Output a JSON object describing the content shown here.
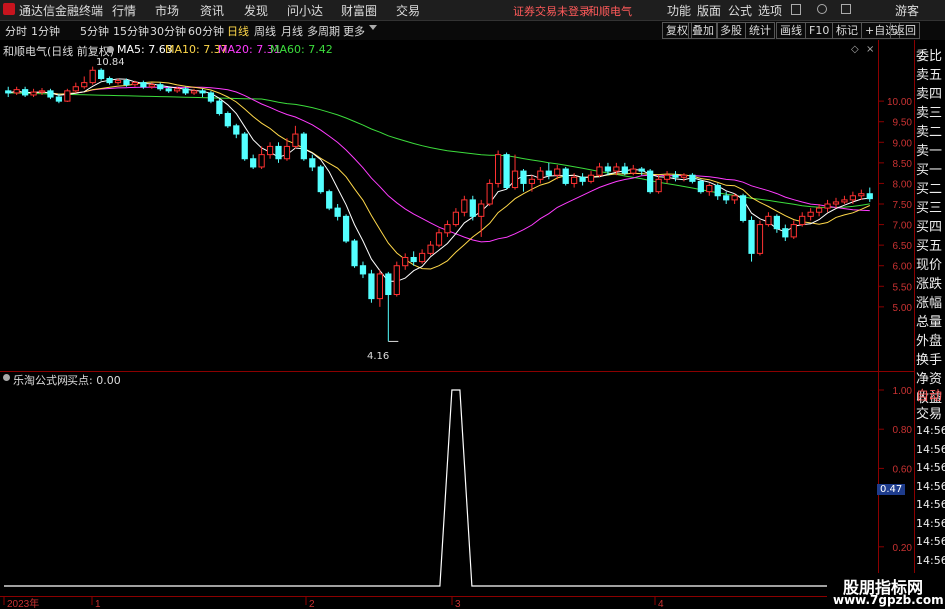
{
  "menubar": {
    "app_title": "通达信金融终端",
    "items": [
      "行情",
      "市场",
      "资讯",
      "发现",
      "问小达",
      "财富圈",
      "交易"
    ],
    "warning": "证券交易未登录",
    "stock_name": "和顺电气",
    "right_items": [
      "功能",
      "版面",
      "公式",
      "选项"
    ],
    "guest": "游客"
  },
  "toolbar": {
    "periods": [
      "分时",
      "1分钟",
      "5分钟",
      "15分钟",
      "30分钟",
      "60分钟",
      "日线",
      "周线",
      "月线",
      "多周期",
      "更多"
    ],
    "active_period": "日线",
    "right_buttons": [
      "复权",
      "叠加",
      "多股",
      "统计",
      "画线",
      "F10",
      "标记",
      "+自选",
      "返回"
    ]
  },
  "main_chart": {
    "title": "和顺电气(日线 前复权)",
    "ma_labels": [
      {
        "name": "MA5: 7.63",
        "color": "#ffffff"
      },
      {
        "name": "MA10: 7.37",
        "color": "#ffd84a"
      },
      {
        "name": "MA20: 7.31",
        "color": "#ff3cff"
      },
      {
        "name": "MA60: 7.42",
        "color": "#3cdc3c"
      }
    ],
    "high_label": "10.84",
    "low_label": "4.16",
    "y_ticks": [
      "10.00",
      "9.50",
      "9.00",
      "8.50",
      "8.00",
      "7.50",
      "7.00",
      "6.50",
      "6.00",
      "5.50",
      "5.00"
    ]
  },
  "indicator": {
    "title": "乐淘公式网",
    "value_label": "买点: 0.00",
    "y_ticks": [
      "1.00",
      "0.80",
      "0.60",
      "0.20"
    ],
    "cursor_value": "0.47"
  },
  "x_axis": {
    "labels": [
      "2023年",
      "1",
      "2",
      "3",
      "4"
    ]
  },
  "right_panel": {
    "items": [
      "委比",
      "卖五",
      "卖四",
      "卖三",
      "卖二",
      "卖一",
      "买一",
      "买二",
      "买三",
      "买四",
      "买五",
      "现价",
      "涨跌",
      "涨幅",
      "总量",
      "外盘",
      "换手",
      "净资",
      "收益"
    ],
    "tabs": [
      "自动",
      "交易"
    ],
    "times": [
      "14:56",
      "14:56",
      "14:56",
      "14:56",
      "14:56",
      "14:56",
      "14:56",
      "14:56",
      "14:56",
      "14:56"
    ]
  },
  "watermark": {
    "line1": "股朋指标网",
    "line2": "www.7gpzb.com"
  },
  "chart_data": {
    "type": "candlestick",
    "ylim": [
      4.0,
      11.0
    ],
    "candles": [
      [
        10.25,
        10.2,
        10.35,
        10.1
      ],
      [
        10.2,
        10.28,
        10.35,
        10.15
      ],
      [
        10.28,
        10.15,
        10.35,
        10.1
      ],
      [
        10.15,
        10.22,
        10.3,
        10.1
      ],
      [
        10.22,
        10.25,
        10.32,
        10.15
      ],
      [
        10.25,
        10.1,
        10.3,
        10.05
      ],
      [
        10.1,
        10.0,
        10.18,
        9.95
      ],
      [
        10.0,
        10.25,
        10.3,
        9.98
      ],
      [
        10.25,
        10.35,
        10.45,
        10.2
      ],
      [
        10.35,
        10.45,
        10.6,
        10.3
      ],
      [
        10.45,
        10.75,
        10.84,
        10.4
      ],
      [
        10.75,
        10.55,
        10.8,
        10.5
      ],
      [
        10.55,
        10.45,
        10.6,
        10.4
      ],
      [
        10.45,
        10.5,
        10.55,
        10.4
      ],
      [
        10.5,
        10.4,
        10.55,
        10.35
      ],
      [
        10.4,
        10.45,
        10.5,
        10.35
      ],
      [
        10.45,
        10.35,
        10.5,
        10.3
      ],
      [
        10.35,
        10.4,
        10.45,
        10.3
      ],
      [
        10.4,
        10.3,
        10.45,
        10.25
      ],
      [
        10.3,
        10.25,
        10.35,
        10.2
      ],
      [
        10.25,
        10.3,
        10.35,
        10.2
      ],
      [
        10.3,
        10.2,
        10.35,
        10.15
      ],
      [
        10.2,
        10.25,
        10.3,
        10.15
      ],
      [
        10.25,
        10.2,
        10.3,
        10.1
      ],
      [
        10.2,
        10.0,
        10.25,
        9.95
      ],
      [
        10.0,
        9.7,
        10.05,
        9.65
      ],
      [
        9.7,
        9.4,
        9.75,
        9.35
      ],
      [
        9.4,
        9.2,
        9.45,
        9.1
      ],
      [
        9.2,
        8.6,
        9.25,
        8.55
      ],
      [
        8.6,
        8.4,
        8.7,
        8.35
      ],
      [
        8.4,
        8.7,
        8.9,
        8.35
      ],
      [
        8.7,
        8.9,
        9.0,
        8.6
      ],
      [
        8.9,
        8.6,
        9.0,
        8.5
      ],
      [
        8.6,
        8.9,
        9.1,
        8.55
      ],
      [
        8.9,
        9.2,
        9.4,
        8.85
      ],
      [
        9.2,
        8.6,
        9.25,
        8.55
      ],
      [
        8.6,
        8.4,
        8.7,
        8.3
      ],
      [
        8.4,
        7.8,
        8.45,
        7.75
      ],
      [
        7.8,
        7.4,
        7.85,
        7.35
      ],
      [
        7.4,
        7.2,
        7.5,
        7.1
      ],
      [
        7.2,
        6.6,
        7.25,
        6.55
      ],
      [
        6.6,
        6.0,
        6.65,
        5.95
      ],
      [
        6.0,
        5.8,
        6.1,
        5.7
      ],
      [
        5.8,
        5.2,
        5.9,
        5.1
      ],
      [
        5.2,
        5.8,
        5.9,
        5.0
      ],
      [
        5.8,
        5.3,
        5.85,
        4.16
      ],
      [
        5.3,
        6.0,
        6.1,
        5.25
      ],
      [
        6.0,
        6.2,
        6.3,
        5.9
      ],
      [
        6.2,
        6.1,
        6.35,
        6.0
      ],
      [
        6.1,
        6.3,
        6.4,
        6.05
      ],
      [
        6.3,
        6.5,
        6.6,
        6.25
      ],
      [
        6.5,
        6.8,
        6.9,
        6.45
      ],
      [
        6.8,
        7.0,
        7.1,
        6.7
      ],
      [
        7.0,
        7.3,
        7.4,
        6.95
      ],
      [
        7.3,
        7.6,
        7.7,
        7.2
      ],
      [
        7.6,
        7.2,
        7.7,
        7.1
      ],
      [
        7.2,
        7.5,
        7.6,
        6.7
      ],
      [
        7.5,
        8.0,
        8.1,
        7.45
      ],
      [
        8.0,
        8.7,
        8.8,
        7.9
      ],
      [
        8.7,
        7.9,
        8.75,
        7.85
      ],
      [
        7.9,
        8.3,
        8.7,
        7.85
      ],
      [
        8.3,
        8.0,
        8.35,
        7.8
      ],
      [
        8.0,
        8.1,
        8.2,
        7.8
      ],
      [
        8.1,
        8.3,
        8.4,
        8.0
      ],
      [
        8.3,
        8.2,
        8.5,
        8.1
      ],
      [
        8.2,
        8.35,
        8.45,
        8.1
      ],
      [
        8.35,
        8.0,
        8.4,
        7.95
      ],
      [
        8.0,
        8.15,
        8.25,
        7.9
      ],
      [
        8.15,
        8.05,
        8.25,
        7.95
      ],
      [
        8.05,
        8.2,
        8.3,
        8.0
      ],
      [
        8.2,
        8.4,
        8.5,
        8.15
      ],
      [
        8.4,
        8.3,
        8.5,
        8.2
      ],
      [
        8.3,
        8.4,
        8.5,
        8.2
      ],
      [
        8.4,
        8.25,
        8.5,
        8.2
      ],
      [
        8.25,
        8.35,
        8.45,
        8.2
      ],
      [
        8.35,
        8.3,
        8.4,
        8.2
      ],
      [
        8.3,
        7.8,
        8.35,
        7.75
      ],
      [
        7.8,
        8.1,
        8.2,
        7.75
      ],
      [
        8.1,
        8.2,
        8.3,
        8.0
      ],
      [
        8.2,
        8.15,
        8.3,
        8.05
      ],
      [
        8.15,
        8.2,
        8.25,
        8.05
      ],
      [
        8.2,
        8.05,
        8.25,
        8.0
      ],
      [
        8.05,
        7.8,
        8.1,
        7.75
      ],
      [
        7.8,
        7.95,
        8.0,
        7.7
      ],
      [
        7.95,
        7.7,
        8.0,
        7.6
      ],
      [
        7.7,
        7.6,
        7.8,
        7.5
      ],
      [
        7.6,
        7.7,
        7.75,
        7.5
      ],
      [
        7.7,
        7.1,
        7.75,
        7.05
      ],
      [
        7.1,
        6.3,
        7.2,
        6.1
      ],
      [
        6.3,
        7.0,
        7.1,
        6.25
      ],
      [
        7.0,
        7.2,
        7.3,
        6.95
      ],
      [
        7.2,
        6.9,
        7.25,
        6.8
      ],
      [
        6.9,
        6.7,
        7.0,
        6.6
      ],
      [
        6.7,
        7.0,
        7.1,
        6.65
      ],
      [
        7.0,
        7.2,
        7.3,
        6.95
      ],
      [
        7.2,
        7.3,
        7.4,
        7.1
      ],
      [
        7.3,
        7.4,
        7.5,
        7.2
      ],
      [
        7.4,
        7.5,
        7.6,
        7.3
      ],
      [
        7.5,
        7.55,
        7.65,
        7.4
      ],
      [
        7.55,
        7.6,
        7.7,
        7.5
      ],
      [
        7.6,
        7.7,
        7.8,
        7.5
      ],
      [
        7.7,
        7.75,
        7.85,
        7.6
      ],
      [
        7.75,
        7.63,
        7.9,
        7.55
      ]
    ],
    "buy_signal": {
      "index": 53,
      "value": 1.0
    }
  }
}
